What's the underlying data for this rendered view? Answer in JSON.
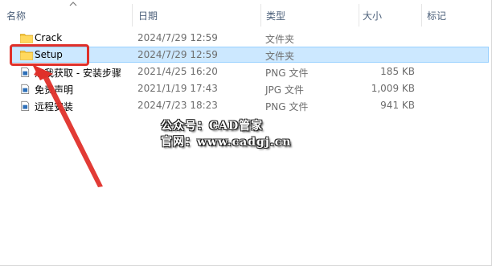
{
  "columns": {
    "name": "名称",
    "date": "日期",
    "type": "类型",
    "size": "大小",
    "tags": "标记"
  },
  "files": [
    {
      "name": "Crack",
      "date": "2024/7/29 12:59",
      "type": "文件夹",
      "size": "",
      "icon": "folder-icon"
    },
    {
      "name": "Setup",
      "date": "2024/7/29 12:59",
      "type": "文件夹",
      "size": "",
      "icon": "folder-icon"
    },
    {
      "name": "点我获取 - 安装步骤",
      "date": "2021/4/25 16:20",
      "type": "PNG 文件",
      "size": "185 KB",
      "icon": "image-file-icon"
    },
    {
      "name": "免责声明",
      "date": "2021/1/19 17:43",
      "type": "JPG 文件",
      "size": "1,009 KB",
      "icon": "image-file-icon"
    },
    {
      "name": "远程安装",
      "date": "2024/7/23 18:23",
      "type": "PNG 文件",
      "size": "941 KB",
      "icon": "image-file-icon"
    }
  ],
  "watermark": {
    "line1": "公众号：CAD管家",
    "line2": "官网：www.cadgj.cn"
  },
  "colors": {
    "selection": "#cce8ff",
    "highlight": "#e0302a",
    "folder": "#f5c842"
  }
}
